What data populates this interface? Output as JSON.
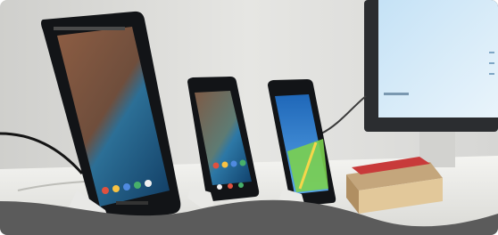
{
  "photo": {
    "subject": "smartphones-on-charging-docks",
    "alt": "",
    "colors": {
      "wall": "#dcdcda",
      "desk": "#efefec",
      "phone_body": "#121417",
      "screen_blue": "#3c86d0",
      "screen_green": "#7bd04f",
      "terrain_brown": "#8d5d43",
      "footer_wave": "#5b5b5b"
    }
  }
}
